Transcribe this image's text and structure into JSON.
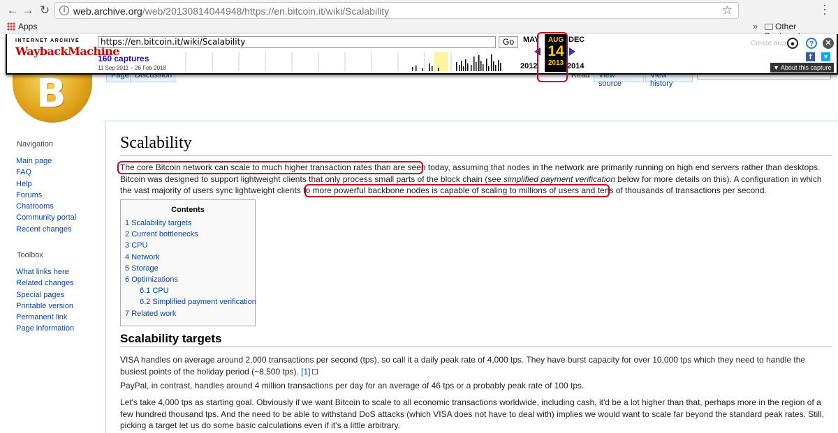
{
  "browser": {
    "url_host": "web.archive.org",
    "url_path": "/web/20130814044948/https://en.bitcoin.it/wiki/Scalability",
    "apps_label": "Apps",
    "other_bookmarks_label": "Other Bookmarks"
  },
  "wayback": {
    "logo_top": "INTERNET ARCHIVE",
    "logo_main": "WaybackMachine",
    "url_value": "https://en.bitcoin.it/wiki/Scalability",
    "go_label": "Go",
    "captures": "160 captures",
    "date_range": "11 Sep 2011 – 26 Feb 2018",
    "prev_month": "MAY",
    "cur_month": "AUG",
    "next_month": "DEC",
    "day": "14",
    "prev_year": "2012",
    "cur_year": "2013",
    "next_year": "2014",
    "create_account": "Create acco",
    "about_label": "About this capture",
    "accent": "#ffcc00"
  },
  "wiki_tabs": {
    "page": "Page",
    "discussion": "Discussion",
    "read": "Read",
    "view_source": "View source",
    "view_history": "View history"
  },
  "sidebar": {
    "nav_heading": "Navigation",
    "nav_items": [
      "Main page",
      "FAQ",
      "Help",
      "Forums",
      "Chatrooms",
      "Community portal",
      "Recent changes"
    ],
    "toolbox_heading": "Toolbox",
    "toolbox_items": [
      "What links here",
      "Related changes",
      "Special pages",
      "Printable version",
      "Permanent link",
      "Page information"
    ]
  },
  "article": {
    "title": "Scalability",
    "intro_highlight_1": "The core Bitcoin network can scale to much higher transaction rates than are seen today,",
    "intro_rest_1": " assuming that nodes in the network are primarily running on high end servers rather than desktops. Bitcoin was designed to support lightweight clients that only process small parts of the block chain (see ",
    "intro_italic": "simplified payment verification",
    "intro_rest_2": " below for more details on this). A configuration in which the vast majority of users sync lightweight clients to more powerful backbone nodes is ",
    "intro_highlight_2": "capable of scaling to millions of users and tens of thousands of transactions per second.",
    "toc_title": "Contents",
    "toc": [
      {
        "num": "1",
        "label": "Scalability targets"
      },
      {
        "num": "2",
        "label": "Current bottlenecks"
      },
      {
        "num": "3",
        "label": "CPU"
      },
      {
        "num": "4",
        "label": "Network"
      },
      {
        "num": "5",
        "label": "Storage"
      },
      {
        "num": "6",
        "label": "Optimizations"
      },
      {
        "num": "6.1",
        "label": "CPU"
      },
      {
        "num": "6.2",
        "label": "Simplified payment verification"
      },
      {
        "num": "7",
        "label": "Related work"
      }
    ],
    "h2": "Scalability targets",
    "p1": "VISA handles on average around 2,000 transactions per second (tps), so call it a daily peak rate of 4,000 tps. They have burst capacity for over 10,000 tps which they need to handle the busiest points of the holiday period (~8,500 tps).",
    "p1_ref": "[1]",
    "p2": "PayPal, in contrast, handles around 4 million transactions per day for an average of 46 tps or a probably peak rate of 100 tps.",
    "p3": "Let's take 4,000 tps as starting goal. Obviously if we want Bitcoin to scale to all economic transactions worldwide, including cash, it'd be a lot higher than that, perhaps more in the region of a few hundred thousand tps. And the need to be able to withstand DoS attacks (which VISA does not have to deal with) implies we would want to scale far beyond the standard peak rates. Still, picking a target let us do some basic calculations even if it's a little arbitrary."
  },
  "highlight_color": "#d0021b"
}
